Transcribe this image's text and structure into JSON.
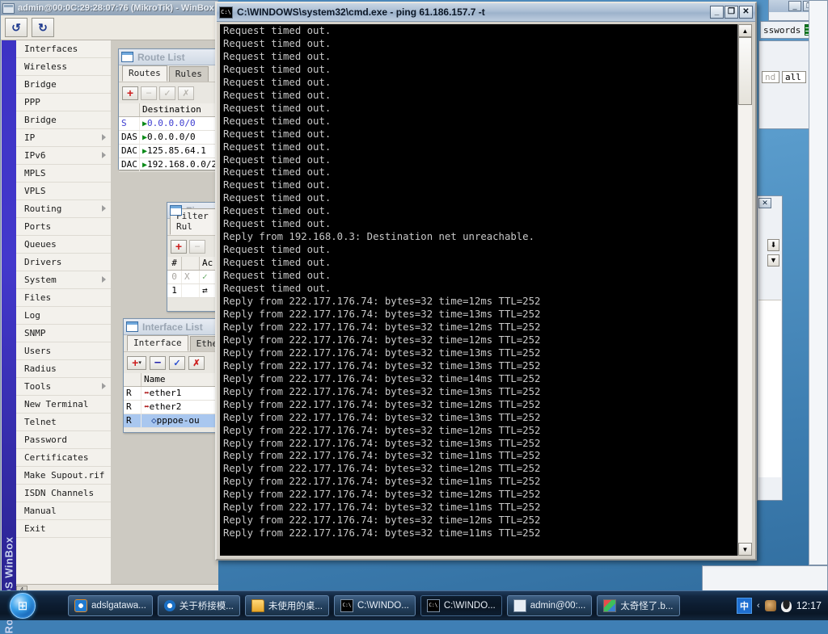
{
  "winbox": {
    "title": "admin@00:0C:29:28:07:76 (MikroTik) - WinBox",
    "sidebar_brand": "RouterOS WinBox",
    "toolbar": {
      "undo_icon": "↺",
      "redo_icon": "↻"
    },
    "menu": [
      {
        "label": "Interfaces",
        "submenu": false
      },
      {
        "label": "Wireless",
        "submenu": false
      },
      {
        "label": "Bridge",
        "submenu": false
      },
      {
        "label": "PPP",
        "submenu": false
      },
      {
        "label": "Bridge",
        "submenu": false
      },
      {
        "label": "IP",
        "submenu": true
      },
      {
        "label": "IPv6",
        "submenu": true
      },
      {
        "label": "MPLS",
        "submenu": false
      },
      {
        "label": "VPLS",
        "submenu": false
      },
      {
        "label": "Routing",
        "submenu": true
      },
      {
        "label": "Ports",
        "submenu": false
      },
      {
        "label": "Queues",
        "submenu": false
      },
      {
        "label": "Drivers",
        "submenu": false
      },
      {
        "label": "System",
        "submenu": true
      },
      {
        "label": "Files",
        "submenu": false
      },
      {
        "label": "Log",
        "submenu": false
      },
      {
        "label": "SNMP",
        "submenu": false
      },
      {
        "label": "Users",
        "submenu": false
      },
      {
        "label": "Radius",
        "submenu": false
      },
      {
        "label": "Tools",
        "submenu": true
      },
      {
        "label": "New Terminal",
        "submenu": false
      },
      {
        "label": "Telnet",
        "submenu": false
      },
      {
        "label": "Password",
        "submenu": false
      },
      {
        "label": "Certificates",
        "submenu": false
      },
      {
        "label": "Make Supout.rif",
        "submenu": false
      },
      {
        "label": "ISDN Channels",
        "submenu": false
      },
      {
        "label": "Manual",
        "submenu": false
      },
      {
        "label": "Exit",
        "submenu": false
      }
    ],
    "hscroll_thumb_label": "4"
  },
  "route_list": {
    "title": "Route List",
    "tabs": [
      {
        "label": "Routes",
        "selected": true
      },
      {
        "label": "Rules",
        "selected": false
      }
    ],
    "toolbar": [
      {
        "name": "add-button",
        "glyph": "+",
        "enabled": true
      },
      {
        "name": "remove-button",
        "glyph": "–",
        "enabled": false
      },
      {
        "name": "enable-button",
        "glyph": "✓",
        "enabled": false
      },
      {
        "name": "disable-button",
        "glyph": "✗",
        "enabled": false
      }
    ],
    "columns": [
      "",
      "Destination"
    ],
    "rows": [
      {
        "flags": "S",
        "destination": "0.0.0.0/0",
        "dim": true
      },
      {
        "flags": "DAS",
        "destination": "0.0.0.0/0",
        "dim": false
      },
      {
        "flags": "DAC",
        "destination": "125.85.64.1",
        "dim": false
      },
      {
        "flags": "DAC",
        "destination": "192.168.0.0/2",
        "dim": false
      }
    ]
  },
  "firewall": {
    "title": "Firewall",
    "tabs": [
      {
        "label": "Filter Rul",
        "selected": true
      }
    ],
    "toolbar": [
      {
        "name": "add-button",
        "glyph": "+",
        "enabled": true
      },
      {
        "name": "remove-button",
        "glyph": "–",
        "enabled": false
      }
    ],
    "columns": [
      "#",
      "",
      "Ac"
    ],
    "rows": [
      {
        "num": "0",
        "x": "X",
        "action": "✓",
        "dim": true
      },
      {
        "num": "1",
        "x": "",
        "action": "⇄",
        "dim": false
      }
    ]
  },
  "interface_list": {
    "title": "Interface List",
    "tabs": [
      {
        "label": "Interface",
        "selected": true
      },
      {
        "label": "Ethern",
        "selected": false
      }
    ],
    "toolbar": [
      {
        "name": "add-button",
        "glyph": "+",
        "enabled": true
      },
      {
        "name": "remove-button",
        "glyph": "–",
        "enabled": true
      },
      {
        "name": "enable-button",
        "glyph": "✓",
        "enabled": true
      },
      {
        "name": "disable-button",
        "glyph": "✗",
        "enabled": true
      }
    ],
    "columns": [
      "",
      "Name"
    ],
    "rows": [
      {
        "flags": "R",
        "name": "ether1",
        "selected": false
      },
      {
        "flags": "R",
        "name": "ether2",
        "selected": false
      },
      {
        "flags": "R",
        "name": "pppoe-ou",
        "selected": true
      }
    ]
  },
  "cmd": {
    "title": "C:\\WINDOWS\\system32\\cmd.exe - ping 61.186.157.7 -t",
    "icon_label": "C:\\",
    "buttons": [
      {
        "name": "minimize-button",
        "glyph": "_"
      },
      {
        "name": "maximize-button",
        "glyph": "❐"
      },
      {
        "name": "close-button",
        "glyph": "✕"
      }
    ],
    "console_lines": [
      "Request timed out.",
      "Request timed out.",
      "Request timed out.",
      "Request timed out.",
      "Request timed out.",
      "Request timed out.",
      "Request timed out.",
      "Request timed out.",
      "Request timed out.",
      "Request timed out.",
      "Request timed out.",
      "Request timed out.",
      "Request timed out.",
      "Request timed out.",
      "Request timed out.",
      "Request timed out.",
      "Reply from 192.168.0.3: Destination net unreachable.",
      "Request timed out.",
      "Request timed out.",
      "Request timed out.",
      "Request timed out.",
      "Reply from 222.177.176.74: bytes=32 time=12ms TTL=252",
      "Reply from 222.177.176.74: bytes=32 time=13ms TTL=252",
      "Reply from 222.177.176.74: bytes=32 time=12ms TTL=252",
      "Reply from 222.177.176.74: bytes=32 time=12ms TTL=252",
      "Reply from 222.177.176.74: bytes=32 time=13ms TTL=252",
      "Reply from 222.177.176.74: bytes=32 time=13ms TTL=252",
      "Reply from 222.177.176.74: bytes=32 time=14ms TTL=252",
      "Reply from 222.177.176.74: bytes=32 time=13ms TTL=252",
      "Reply from 222.177.176.74: bytes=32 time=12ms TTL=252",
      "Reply from 222.177.176.74: bytes=32 time=13ms TTL=252",
      "Reply from 222.177.176.74: bytes=32 time=12ms TTL=252",
      "Reply from 222.177.176.74: bytes=32 time=13ms TTL=252",
      "Reply from 222.177.176.74: bytes=32 time=11ms TTL=252",
      "Reply from 222.177.176.74: bytes=32 time=12ms TTL=252",
      "Reply from 222.177.176.74: bytes=32 time=11ms TTL=252",
      "Reply from 222.177.176.74: bytes=32 time=12ms TTL=252",
      "Reply from 222.177.176.74: bytes=32 time=11ms TTL=252",
      "Reply from 222.177.176.74: bytes=32 time=12ms TTL=252",
      "Reply from 222.177.176.74: bytes=32 time=11ms TTL=252"
    ]
  },
  "bg_windows": {
    "passwords_label": "sswords",
    "find_label": "nd",
    "all_value": "all",
    "top_buttons": [
      {
        "name": "minimize-button",
        "glyph": "_"
      },
      {
        "name": "restore-button",
        "glyph": "❐"
      },
      {
        "name": "close-button",
        "glyph": "✕"
      }
    ],
    "close_glyph": "✕"
  },
  "taskbar": {
    "start_label": "⊞",
    "buttons": [
      {
        "label": "adslgatawa...",
        "icon": "internet-explorer-icon",
        "active": false
      },
      {
        "label": "关于桥接模...",
        "icon": "maxthon-icon",
        "active": false
      },
      {
        "label": "未使用的桌...",
        "icon": "folder-icon",
        "active": false
      },
      {
        "label": "C:\\WINDO...",
        "icon": "cmd-icon",
        "active": false
      },
      {
        "label": "C:\\WINDO...",
        "icon": "cmd-icon",
        "active": true
      },
      {
        "label": "admin@00:...",
        "icon": "winbox-icon",
        "active": false
      },
      {
        "label": "太奇怪了.b...",
        "icon": "paint-icon",
        "active": false
      }
    ],
    "tray": {
      "ime": "中",
      "icons": [
        "chevron-left-icon",
        "network-icon",
        "penguin-icon"
      ],
      "clock": "12:17"
    }
  }
}
